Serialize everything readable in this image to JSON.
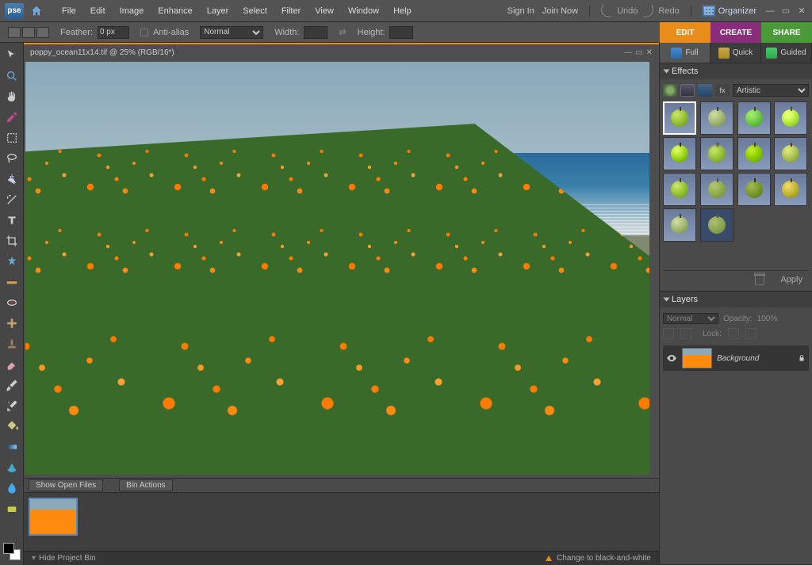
{
  "app": {
    "logo": "pse"
  },
  "menubar": {
    "items": [
      "File",
      "Edit",
      "Image",
      "Enhance",
      "Layer",
      "Select",
      "Filter",
      "View",
      "Window",
      "Help"
    ],
    "sign_in": "Sign In",
    "join_now": "Join Now",
    "undo": "Undo",
    "redo": "Redo",
    "organizer": "Organizer"
  },
  "options": {
    "feather_label": "Feather:",
    "feather_value": "0 px",
    "antialias_label": "Anti-alias",
    "mode_value": "Normal",
    "width_label": "Width:",
    "height_label": "Height:"
  },
  "modes": {
    "edit": "EDIT",
    "create": "CREATE",
    "share": "SHARE"
  },
  "document": {
    "title": "poppy_ocean11x14.tif @ 25% (RGB/16*)"
  },
  "bin": {
    "show_open": "Show Open Files",
    "bin_actions": "Bin Actions",
    "hide": "Hide Project Bin"
  },
  "status": {
    "right": "Change to black-and-white"
  },
  "viewtabs": {
    "full": "Full",
    "quick": "Quick",
    "guided": "Guided"
  },
  "effects": {
    "title": "Effects",
    "category": "Artistic",
    "apply": "Apply",
    "fxlabel": "fx"
  },
  "layers": {
    "title": "Layers",
    "blend": "Normal",
    "opacity_label": "Opacity:",
    "opacity_value": "100%",
    "lock_label": "Lock:",
    "bg_name": "Background"
  }
}
